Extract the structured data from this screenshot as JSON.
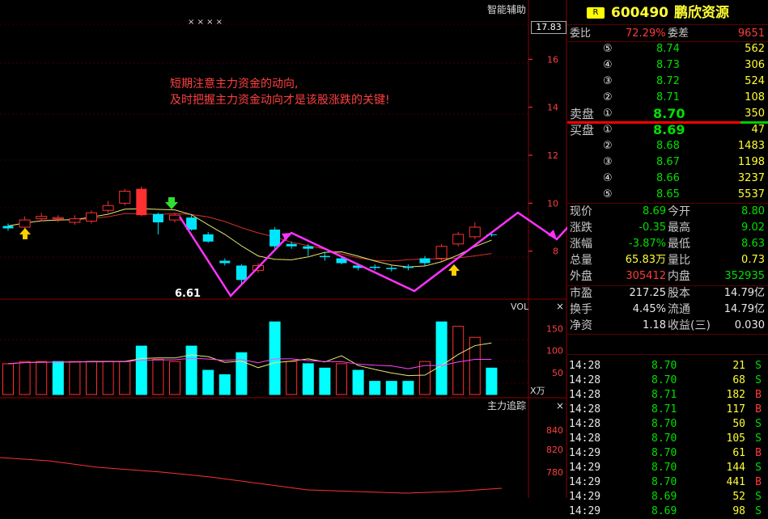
{
  "stock": {
    "badge": "R",
    "code": "600490",
    "name": "鹏欣资源"
  },
  "chart": {
    "title_top": "智能辅助",
    "marker_text": "× × × ×",
    "current_price_tag": "17.83",
    "y_ticks_main": [
      "16",
      "14",
      "12",
      "10",
      "8"
    ],
    "low_label": "6.61",
    "annotation_line1": "短期注意主力资金的动向,",
    "annotation_line2": "及时把握主力资金动向才是该股涨跌的关键!",
    "vol_label": "VOL",
    "vol_ticks": [
      "150",
      "100",
      "50"
    ],
    "vol_unit": "X万",
    "tracker_label": "主力追踪",
    "tracker_ticks": [
      "840",
      "820",
      "780"
    ],
    "close_symbol": "×"
  },
  "chart_data": {
    "type": "candlestick",
    "ylim": [
      6,
      18
    ],
    "candles": [
      {
        "o": 8.95,
        "c": 9.05,
        "h": 9.15,
        "l": 8.85,
        "up": false
      },
      {
        "o": 9.0,
        "c": 9.3,
        "h": 9.45,
        "l": 8.9,
        "up": true
      },
      {
        "o": 9.35,
        "c": 9.45,
        "h": 9.6,
        "l": 9.25,
        "up": true
      },
      {
        "o": 9.35,
        "c": 9.4,
        "h": 9.5,
        "l": 9.2,
        "up": true
      },
      {
        "o": 9.2,
        "c": 9.35,
        "h": 9.5,
        "l": 9.1,
        "up": true
      },
      {
        "o": 9.25,
        "c": 9.6,
        "h": 9.7,
        "l": 9.15,
        "up": true
      },
      {
        "o": 9.7,
        "c": 9.9,
        "h": 10.1,
        "l": 9.6,
        "up": true
      },
      {
        "o": 10.0,
        "c": 10.5,
        "h": 10.6,
        "l": 9.9,
        "up": true
      },
      {
        "o": 10.6,
        "c": 9.5,
        "h": 10.7,
        "l": 9.45,
        "up": true,
        "solid": true
      },
      {
        "o": 9.55,
        "c": 9.2,
        "h": 9.6,
        "l": 8.7,
        "up": true
      },
      {
        "o": 9.3,
        "c": 9.5,
        "h": 9.6,
        "l": 9.2,
        "up": true
      },
      {
        "o": 9.4,
        "c": 8.9,
        "h": 9.5,
        "l": 8.85,
        "up": false
      },
      {
        "o": 8.7,
        "c": 8.4,
        "h": 8.8,
        "l": 8.35,
        "up": false
      },
      {
        "o": 7.6,
        "c": 7.5,
        "h": 7.7,
        "l": 7.4,
        "up": false
      },
      {
        "o": 7.4,
        "c": 6.8,
        "h": 7.45,
        "l": 6.61,
        "up": false
      },
      {
        "o": 7.2,
        "c": 7.4,
        "h": 7.5,
        "l": 7.1,
        "up": true
      },
      {
        "o": 8.9,
        "c": 8.2,
        "h": 9.0,
        "l": 8.1,
        "up": false
      },
      {
        "o": 8.2,
        "c": 8.3,
        "h": 8.4,
        "l": 8.1,
        "up": false
      },
      {
        "o": 8.2,
        "c": 8.1,
        "h": 8.3,
        "l": 7.8,
        "up": false
      },
      {
        "o": 7.8,
        "c": 7.75,
        "h": 7.95,
        "l": 7.6,
        "up": false
      },
      {
        "o": 7.7,
        "c": 7.5,
        "h": 7.8,
        "l": 7.45,
        "up": false
      },
      {
        "o": 7.4,
        "c": 7.3,
        "h": 7.5,
        "l": 7.2,
        "up": false
      },
      {
        "o": 7.35,
        "c": 7.3,
        "h": 7.45,
        "l": 7.2,
        "up": false
      },
      {
        "o": 7.3,
        "c": 7.25,
        "h": 7.4,
        "l": 7.15,
        "up": false
      },
      {
        "o": 7.3,
        "c": 7.35,
        "h": 7.45,
        "l": 7.2,
        "up": false
      },
      {
        "o": 7.5,
        "c": 7.7,
        "h": 7.8,
        "l": 7.4,
        "up": false
      },
      {
        "o": 7.7,
        "c": 8.2,
        "h": 8.3,
        "l": 7.6,
        "up": true
      },
      {
        "o": 8.3,
        "c": 8.7,
        "h": 8.8,
        "l": 8.2,
        "up": true
      },
      {
        "o": 8.6,
        "c": 9.0,
        "h": 9.2,
        "l": 8.5,
        "up": true
      },
      {
        "o": 8.7,
        "c": 8.69,
        "h": 8.8,
        "l": 8.6,
        "up": true
      }
    ],
    "volume": [
      70,
      75,
      75,
      75,
      75,
      75,
      75,
      75,
      110,
      80,
      75,
      110,
      55,
      45,
      95,
      0,
      165,
      75,
      70,
      60,
      70,
      55,
      30,
      30,
      30,
      75,
      165,
      155,
      130,
      60
    ],
    "volume_cyan": [
      false,
      false,
      false,
      true,
      false,
      false,
      false,
      false,
      true,
      false,
      false,
      true,
      true,
      true,
      true,
      false,
      true,
      false,
      true,
      true,
      false,
      true,
      true,
      true,
      true,
      false,
      true,
      false,
      false,
      true
    ]
  },
  "quote": {
    "weibi_label": "委比",
    "weibi": "72.29%",
    "weicha_label": "委差",
    "weicha": "9651",
    "sell_label": "卖盘",
    "buy_label": "买盘",
    "asks": [
      {
        "n": "⑤",
        "p": "8.74",
        "v": "562"
      },
      {
        "n": "④",
        "p": "8.73",
        "v": "306"
      },
      {
        "n": "③",
        "p": "8.72",
        "v": "524"
      },
      {
        "n": "②",
        "p": "8.71",
        "v": "108"
      },
      {
        "n": "①",
        "p": "8.70",
        "v": "350"
      }
    ],
    "bids": [
      {
        "n": "①",
        "p": "8.69",
        "v": "47"
      },
      {
        "n": "②",
        "p": "8.68",
        "v": "1483"
      },
      {
        "n": "③",
        "p": "8.67",
        "v": "1198"
      },
      {
        "n": "④",
        "p": "8.66",
        "v": "3237"
      },
      {
        "n": "⑤",
        "p": "8.65",
        "v": "5537"
      }
    ],
    "stats": [
      {
        "l1": "现价",
        "v1": "8.69",
        "c1": "green",
        "l2": "今开",
        "v2": "8.80",
        "c2": "green"
      },
      {
        "l1": "涨跌",
        "v1": "-0.35",
        "c1": "green",
        "l2": "最高",
        "v2": "9.02",
        "c2": "green"
      },
      {
        "l1": "涨幅",
        "v1": "-3.87%",
        "c1": "green",
        "l2": "最低",
        "v2": "8.63",
        "c2": "green"
      },
      {
        "l1": "总量",
        "v1": "65.83万",
        "c1": "yellow",
        "l2": "量比",
        "v2": "0.73",
        "c2": "yellow"
      },
      {
        "l1": "外盘",
        "v1": "305412",
        "c1": "red",
        "l2": "内盘",
        "v2": "352935",
        "c2": "green"
      }
    ],
    "fund": [
      {
        "l1": "市盈",
        "v1": "217.25",
        "l2": "股本",
        "v2": "14.79亿"
      },
      {
        "l1": "换手",
        "v1": "4.45%",
        "l2": "流通",
        "v2": "14.79亿"
      },
      {
        "l1": "净资",
        "v1": "1.18",
        "l2": "收益(三)",
        "v2": "0.030"
      }
    ],
    "ticks": [
      {
        "t": "14:28",
        "p": "8.70",
        "v": "21",
        "s": "S"
      },
      {
        "t": "14:28",
        "p": "8.70",
        "v": "68",
        "s": "S"
      },
      {
        "t": "14:28",
        "p": "8.71",
        "v": "182",
        "s": "B"
      },
      {
        "t": "14:28",
        "p": "8.71",
        "v": "117",
        "s": "B"
      },
      {
        "t": "14:28",
        "p": "8.70",
        "v": "50",
        "s": "S"
      },
      {
        "t": "14:28",
        "p": "8.70",
        "v": "105",
        "s": "S"
      },
      {
        "t": "14:29",
        "p": "8.70",
        "v": "61",
        "s": "B"
      },
      {
        "t": "14:29",
        "p": "8.70",
        "v": "144",
        "s": "S"
      },
      {
        "t": "14:29",
        "p": "8.70",
        "v": "441",
        "s": "B"
      },
      {
        "t": "14:29",
        "p": "8.69",
        "v": "52",
        "s": "S"
      },
      {
        "t": "14:29",
        "p": "8.69",
        "v": "98",
        "s": "S"
      }
    ]
  }
}
